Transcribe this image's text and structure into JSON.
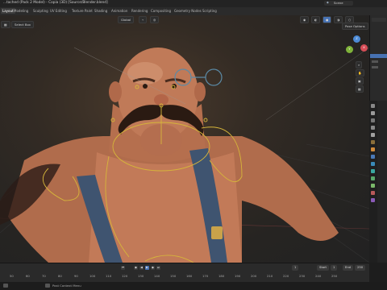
{
  "app": {
    "title": "...tached (Pack 2 Model) - Copia (3D) [Source/Blender.blend]",
    "scene_label": "Scene"
  },
  "workspace_tabs": [
    {
      "label": "Layout",
      "active": true
    },
    {
      "label": "Modeling"
    },
    {
      "label": "Sculpting"
    },
    {
      "label": "UV Editing"
    },
    {
      "label": "Texture Paint"
    },
    {
      "label": "Shading"
    },
    {
      "label": "Animation"
    },
    {
      "label": "Rendering"
    },
    {
      "label": "Compositing"
    },
    {
      "label": "Geometry Nodes"
    },
    {
      "label": "Scripting"
    }
  ],
  "viewport_header": {
    "select_box": "Select Box",
    "transform": "Global",
    "pose_options": "Pose Options"
  },
  "gizmo": {
    "x": "X",
    "y": "Y",
    "z": "Z"
  },
  "timeline": {
    "start_label": "Start",
    "start_value": "1",
    "end_label": "End",
    "end_value": "250",
    "current_frame": "1",
    "ticks": [
      "50",
      "60",
      "70",
      "80",
      "90",
      "100",
      "110",
      "120",
      "130",
      "140",
      "150",
      "160",
      "170",
      "180",
      "190",
      "200",
      "210",
      "220",
      "230",
      "240",
      "250"
    ]
  },
  "statusbar": {
    "text": "Post Context Menu"
  },
  "colors": {
    "accent_blue": "#4772b3",
    "bone_yellow": "#d6b63a",
    "rig_blue": "#5b8aa6",
    "skin": "#c27a58"
  }
}
